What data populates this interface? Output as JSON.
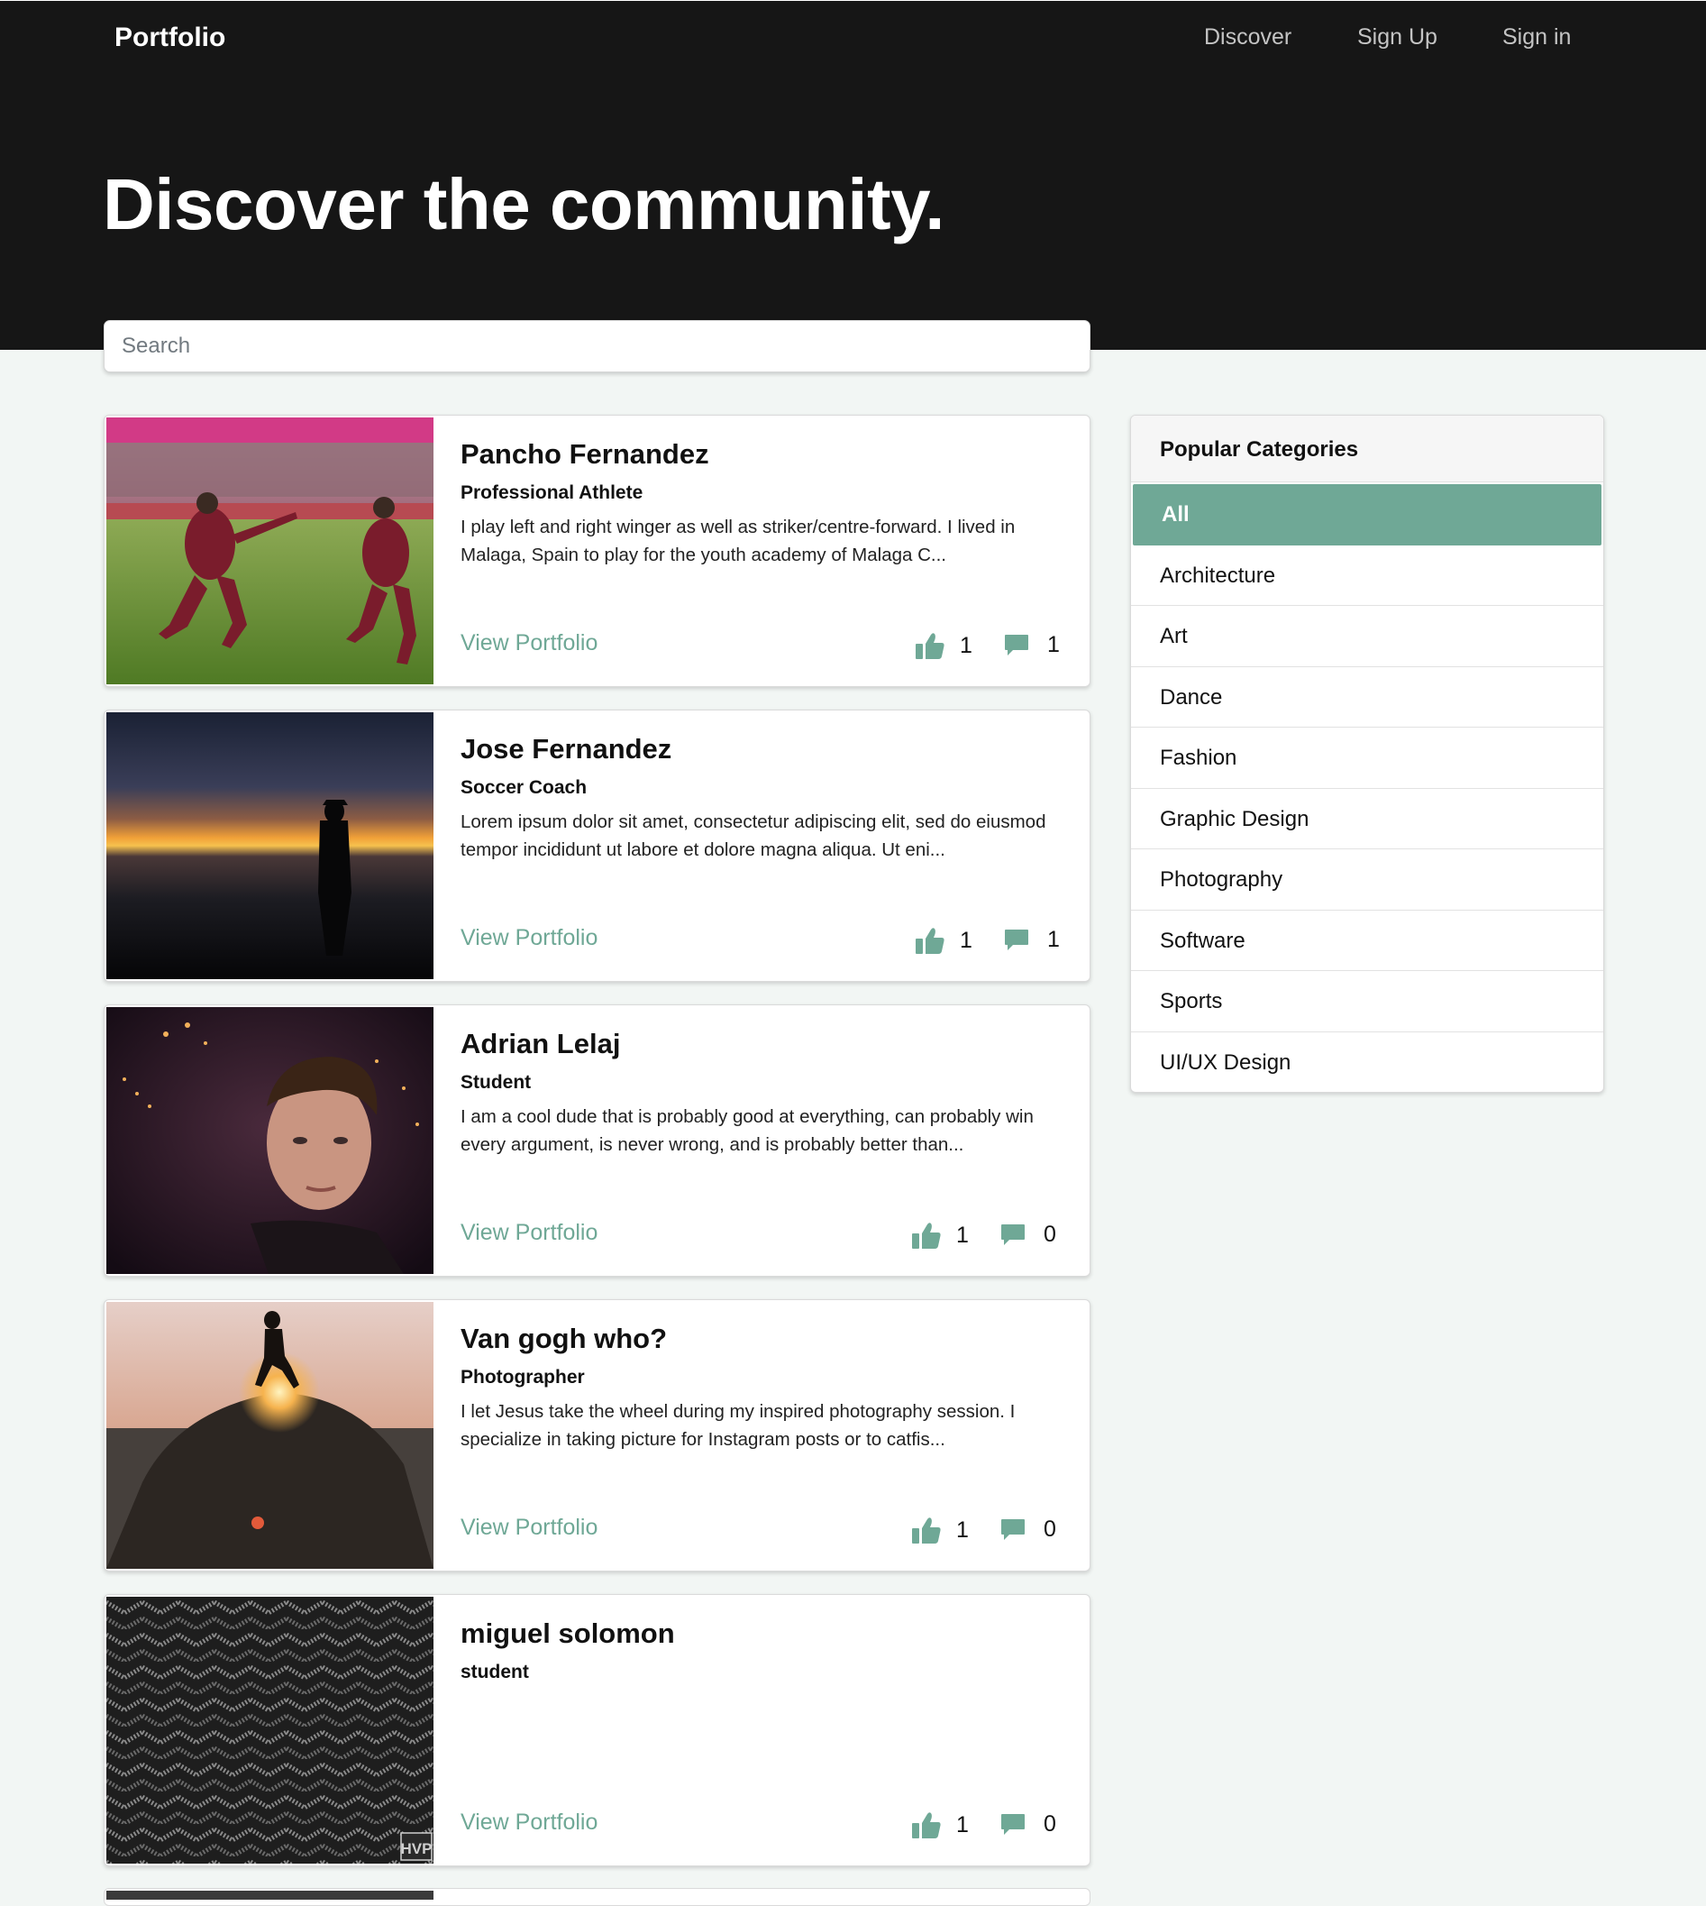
{
  "header": {
    "brand": "Portfolio",
    "nav": {
      "discover": "Discover",
      "signup": "Sign Up",
      "signin": "Sign in"
    },
    "hero": "Discover the community."
  },
  "search": {
    "placeholder": "Search",
    "value": ""
  },
  "colors": {
    "accent": "#6fa896",
    "header_bg": "#161616",
    "page_bg": "#f2f6f4"
  },
  "cards": [
    {
      "name": "Pancho Fernandez",
      "role": "Professional Athlete",
      "description": "I play left and right winger as well as striker/centre-forward. I lived in Malaga, Spain to play for the youth academy of Malaga C...",
      "link": "View Portfolio",
      "likes": "1",
      "comments": "1",
      "image": "soccer-players-celebrating-photo"
    },
    {
      "name": "Jose Fernandez",
      "role": "Soccer Coach",
      "description": "Lorem ipsum dolor sit amet, consectetur adipiscing elit, sed do eiusmod tempor incididunt ut labore et dolore magna aliqua. Ut eni...",
      "link": "View Portfolio",
      "likes": "1",
      "comments": "1",
      "image": "sunset-silhouette-photo"
    },
    {
      "name": "Adrian Lelaj",
      "role": "Student",
      "description": "I am a cool dude that is probably good at everything, can probably win every argument, is never wrong, and is probably better than...",
      "link": "View Portfolio",
      "likes": "1",
      "comments": "0",
      "image": "portrait-photo"
    },
    {
      "name": "Van gogh who?",
      "role": "Photographer",
      "description": "I let Jesus take the wheel during my inspired photography session. I specialize in taking picture for Instagram posts or to catfis...",
      "link": "View Portfolio",
      "likes": "1",
      "comments": "0",
      "image": "person-walking-on-rock-sunset-photo"
    },
    {
      "name": "miguel solomon",
      "role": "student",
      "description": "",
      "link": "View Portfolio",
      "likes": "1",
      "comments": "0",
      "image": "goyard-pattern-image",
      "image_text": "HVP"
    }
  ],
  "categories": {
    "title": "Popular Categories",
    "items": [
      "All",
      "Architecture",
      "Art",
      "Dance",
      "Fashion",
      "Graphic Design",
      "Photography",
      "Software",
      "Sports",
      "UI/UX Design"
    ],
    "active": "All"
  }
}
